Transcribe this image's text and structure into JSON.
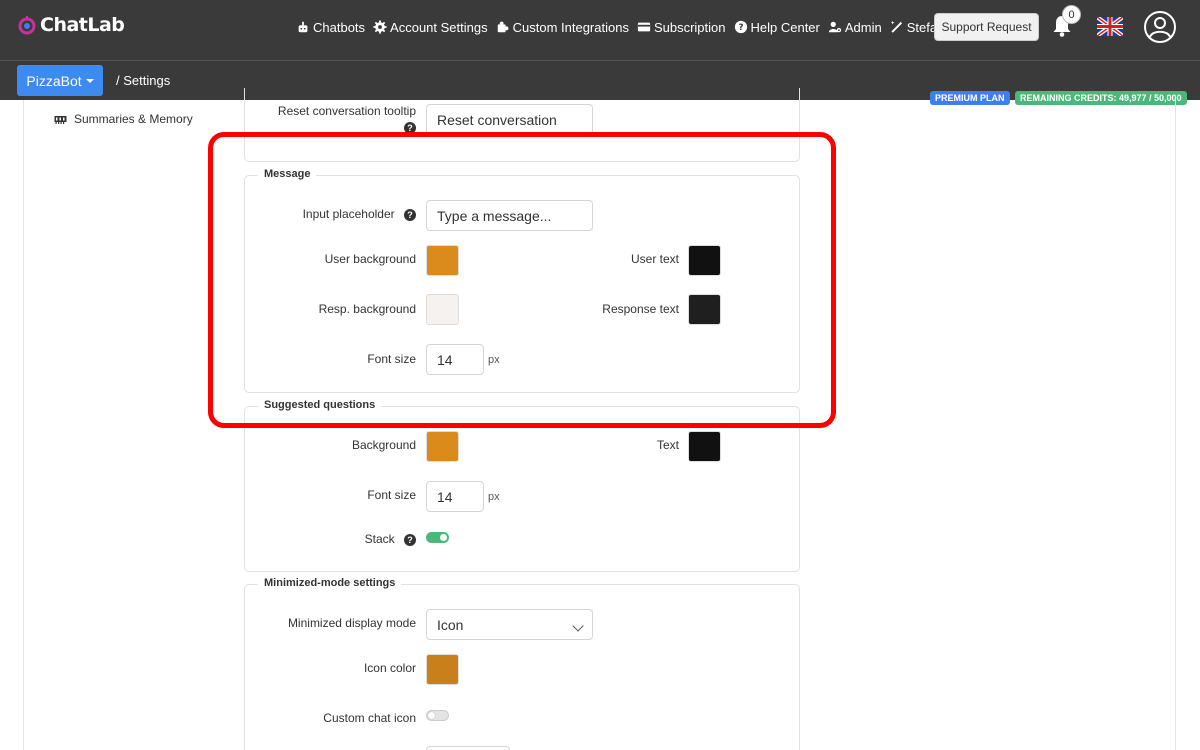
{
  "brand": {
    "name": "ChatLab"
  },
  "nav": {
    "items": [
      {
        "label": "Chatbots",
        "icon": "robot-icon"
      },
      {
        "label": "Account Settings",
        "icon": "gear-icon"
      },
      {
        "label": "Custom Integrations",
        "icon": "puzzle-icon"
      },
      {
        "label": "Subscription",
        "icon": "card-icon"
      },
      {
        "label": "Help Center",
        "icon": "question-icon"
      },
      {
        "label": "Admin",
        "icon": "user-gear-icon"
      },
      {
        "label": "Stefan AI",
        "icon": "magic-wand-icon"
      }
    ],
    "support_label": "Support Request",
    "notification_count": "0"
  },
  "subbar": {
    "bot_name": "PizzaBot",
    "breadcrumb": "/  Settings",
    "plan_badge": "PREMIUM PLAN",
    "credits_badge": "REMAINING CREDITS: 49,977 / 50,000"
  },
  "sidebar": {
    "item": "Summaries & Memory"
  },
  "top_section": {
    "reset_label": "Reset conversation tooltip",
    "reset_value": "Reset conversation"
  },
  "message": {
    "legend": "Message",
    "input_placeholder_label": "Input placeholder",
    "input_placeholder_value": "Type a message...",
    "user_bg_label": "User background",
    "user_bg_color": "#da8b1c",
    "user_text_label": "User text",
    "user_text_color": "#111111",
    "resp_bg_label": "Resp. background",
    "resp_bg_color": "#f5f2ef",
    "resp_text_label": "Response text",
    "resp_text_color": "#1f1f1f",
    "font_size_label": "Font size",
    "font_size_value": "14",
    "unit": "px"
  },
  "suggested": {
    "legend": "Suggested questions",
    "bg_label": "Background",
    "bg_color": "#da8b1c",
    "text_label": "Text",
    "text_color": "#111111",
    "font_size_label": "Font size",
    "font_size_value": "14",
    "unit": "px",
    "stack_label": "Stack",
    "stack_on": true
  },
  "minimized": {
    "legend": "Minimized-mode settings",
    "display_label": "Minimized display mode",
    "display_value": "Icon",
    "icon_color_label": "Icon color",
    "icon_color": "#c9801a",
    "custom_icon_label": "Custom chat icon",
    "custom_icon_on": false
  },
  "colors": {
    "highlight": "#ff0000",
    "accent": "#3d8bf0",
    "success": "#4bb87a",
    "topbar": "#3a3a3a"
  }
}
